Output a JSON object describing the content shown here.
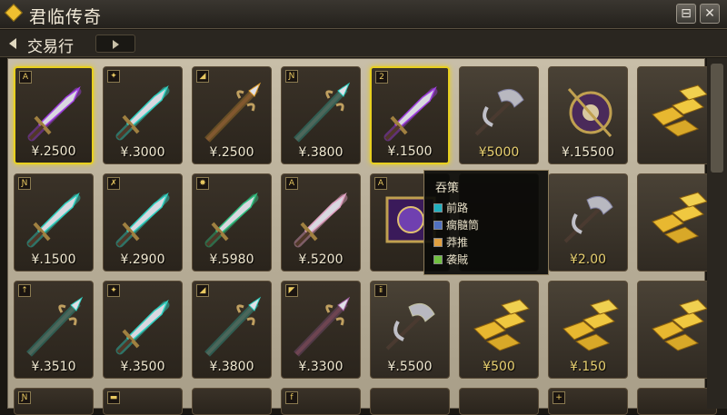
{
  "window": {
    "title": "君临传奇",
    "minimize_symbol": "⊟",
    "close_symbol": "✕"
  },
  "tabs": {
    "active_label": "交易行"
  },
  "items": [
    {
      "badge": "A",
      "price": "¥.2500",
      "type": "sword",
      "glow": "#a040e0",
      "selected": true
    },
    {
      "badge": "✦",
      "price": "¥.3000",
      "type": "sword",
      "glow": "#30d0c0",
      "selected": false
    },
    {
      "badge": "◢",
      "price": "¥.2500",
      "type": "spear",
      "glow": "#e0a030",
      "selected": false
    },
    {
      "badge": "Ɲ",
      "price": "¥.3800",
      "type": "spear",
      "glow": "#30d0c0",
      "selected": false
    },
    {
      "badge": "2",
      "price": "¥.1500",
      "type": "sword",
      "glow": "#a040e0",
      "selected": true
    },
    {
      "badge": "",
      "price": "¥5000",
      "type": "axe",
      "glow": "#8080a0",
      "selected": false,
      "gold_price": true
    },
    {
      "badge": "",
      "price": "¥.15500",
      "type": "hammer",
      "glow": "#8050b0",
      "selected": false
    },
    {
      "badge": "",
      "price": "",
      "type": "gold",
      "glow": "#e0b030",
      "selected": false
    },
    {
      "badge": "Ɲ",
      "price": "¥.1500",
      "type": "sword",
      "glow": "#30d0c0",
      "selected": false
    },
    {
      "badge": "✗",
      "price": "¥.2900",
      "type": "sword",
      "glow": "#30d0c0",
      "selected": false
    },
    {
      "badge": "✸",
      "price": "¥.5980",
      "type": "sword",
      "glow": "#30c080",
      "selected": false
    },
    {
      "badge": "A",
      "price": "¥.5200",
      "type": "sword",
      "glow": "#e0a0c0",
      "selected": false
    },
    {
      "badge": "A",
      "price": "",
      "type": "shield",
      "glow": "#a040e0",
      "selected": false
    },
    {
      "badge": "",
      "price": "",
      "type": "hidden",
      "glow": "#705830",
      "selected": false
    },
    {
      "badge": "",
      "price": "¥2.00",
      "type": "axe",
      "glow": "#8080a0",
      "selected": false,
      "gold_price": true
    },
    {
      "badge": "",
      "price": "",
      "type": "gold",
      "glow": "#e0b030",
      "selected": false
    },
    {
      "badge": "↑",
      "price": "¥.3510",
      "type": "spear",
      "glow": "#30d0c0",
      "selected": false
    },
    {
      "badge": "✦",
      "price": "¥.3500",
      "type": "sword",
      "glow": "#30d0c0",
      "selected": false
    },
    {
      "badge": "◢",
      "price": "¥.3800",
      "type": "spear",
      "glow": "#30d0c0",
      "selected": false
    },
    {
      "badge": "◤",
      "price": "¥.3300",
      "type": "spear",
      "glow": "#a060a0",
      "selected": false
    },
    {
      "badge": "ⅱ",
      "price": "¥.5500",
      "type": "axe",
      "glow": "#c0c0a0",
      "selected": false
    },
    {
      "badge": "",
      "price": "¥500",
      "type": "gold",
      "glow": "#e0b030",
      "selected": false,
      "gold_price": true
    },
    {
      "badge": "",
      "price": "¥.150",
      "type": "gold",
      "glow": "#e0b030",
      "selected": false,
      "gold_price": true
    },
    {
      "badge": "",
      "price": "",
      "type": "gold",
      "glow": "#e0b030",
      "selected": false
    }
  ],
  "bottom_badges": [
    "Ɲ",
    "▬",
    "",
    "f",
    "",
    "",
    "+",
    ""
  ],
  "tooltip": {
    "title": "吞策",
    "entries": [
      {
        "label": "前路",
        "color": "#20b0c0"
      },
      {
        "label": "瘸髓筒",
        "color": "#5070c0"
      },
      {
        "label": "莽推",
        "color": "#e0a040"
      },
      {
        "label": "袭賊",
        "color": "#70c040"
      }
    ]
  }
}
